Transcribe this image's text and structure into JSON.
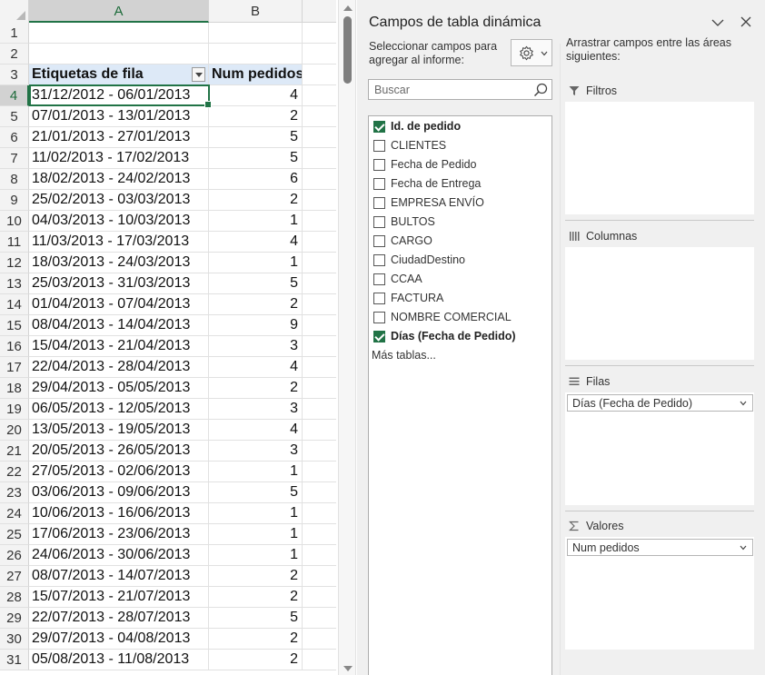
{
  "sheet": {
    "columns": [
      "A",
      "B"
    ],
    "selected_column": "A",
    "selected_row": "4",
    "header_row": {
      "number": "3",
      "label_col": "Etiquetas de fila",
      "value_col": "Num pedidos"
    },
    "empty_rows": [
      "1",
      "2"
    ],
    "rows": [
      {
        "n": "4",
        "label": "31/12/2012 - 06/01/2013",
        "value": "4"
      },
      {
        "n": "5",
        "label": "07/01/2013 - 13/01/2013",
        "value": "2"
      },
      {
        "n": "6",
        "label": "21/01/2013 - 27/01/2013",
        "value": "5"
      },
      {
        "n": "7",
        "label": "11/02/2013 - 17/02/2013",
        "value": "5"
      },
      {
        "n": "8",
        "label": "18/02/2013 - 24/02/2013",
        "value": "6"
      },
      {
        "n": "9",
        "label": "25/02/2013 - 03/03/2013",
        "value": "2"
      },
      {
        "n": "10",
        "label": "04/03/2013 - 10/03/2013",
        "value": "1"
      },
      {
        "n": "11",
        "label": "11/03/2013 - 17/03/2013",
        "value": "4"
      },
      {
        "n": "12",
        "label": "18/03/2013 - 24/03/2013",
        "value": "1"
      },
      {
        "n": "13",
        "label": "25/03/2013 - 31/03/2013",
        "value": "5"
      },
      {
        "n": "14",
        "label": "01/04/2013 - 07/04/2013",
        "value": "2"
      },
      {
        "n": "15",
        "label": "08/04/2013 - 14/04/2013",
        "value": "9"
      },
      {
        "n": "16",
        "label": "15/04/2013 - 21/04/2013",
        "value": "3"
      },
      {
        "n": "17",
        "label": "22/04/2013 - 28/04/2013",
        "value": "4"
      },
      {
        "n": "18",
        "label": "29/04/2013 - 05/05/2013",
        "value": "2"
      },
      {
        "n": "19",
        "label": "06/05/2013 - 12/05/2013",
        "value": "3"
      },
      {
        "n": "20",
        "label": "13/05/2013 - 19/05/2013",
        "value": "4"
      },
      {
        "n": "21",
        "label": "20/05/2013 - 26/05/2013",
        "value": "3"
      },
      {
        "n": "22",
        "label": "27/05/2013 - 02/06/2013",
        "value": "1"
      },
      {
        "n": "23",
        "label": "03/06/2013 - 09/06/2013",
        "value": "5"
      },
      {
        "n": "24",
        "label": "10/06/2013 - 16/06/2013",
        "value": "1"
      },
      {
        "n": "25",
        "label": "17/06/2013 - 23/06/2013",
        "value": "1"
      },
      {
        "n": "26",
        "label": "24/06/2013 - 30/06/2013",
        "value": "1"
      },
      {
        "n": "27",
        "label": "08/07/2013 - 14/07/2013",
        "value": "2"
      },
      {
        "n": "28",
        "label": "15/07/2013 - 21/07/2013",
        "value": "2"
      },
      {
        "n": "29",
        "label": "22/07/2013 - 28/07/2013",
        "value": "5"
      },
      {
        "n": "30",
        "label": "29/07/2013 - 04/08/2013",
        "value": "2"
      },
      {
        "n": "31",
        "label": "05/08/2013 - 11/08/2013",
        "value": "2"
      }
    ]
  },
  "pane": {
    "title": "Campos de tabla dinámica",
    "choose_fields_label": "Seleccionar campos para agregar al informe:",
    "search_placeholder": "Buscar",
    "fields": [
      {
        "label": "Id. de pedido",
        "checked": true
      },
      {
        "label": "CLIENTES",
        "checked": false
      },
      {
        "label": "Fecha de Pedido",
        "checked": false
      },
      {
        "label": "Fecha de Entrega",
        "checked": false
      },
      {
        "label": "EMPRESA ENVÍO",
        "checked": false
      },
      {
        "label": "BULTOS",
        "checked": false
      },
      {
        "label": "CARGO",
        "checked": false
      },
      {
        "label": "CiudadDestino",
        "checked": false
      },
      {
        "label": "CCAA",
        "checked": false
      },
      {
        "label": "FACTURA",
        "checked": false
      },
      {
        "label": "NOMBRE COMERCIAL",
        "checked": false
      },
      {
        "label": "Días (Fecha de Pedido)",
        "checked": true
      }
    ],
    "more_tables": "Más tablas...",
    "drag_label": "Arrastrar campos entre las áreas siguientes:",
    "areas": {
      "filters": {
        "label": "Filtros",
        "icon": "filter-icon",
        "items": []
      },
      "columns": {
        "label": "Columnas",
        "icon": "columns-icon",
        "items": []
      },
      "rows": {
        "label": "Filas",
        "icon": "rows-icon",
        "items": [
          "Días (Fecha de Pedido)"
        ]
      },
      "values": {
        "label": "Valores",
        "icon": "sigma-icon",
        "items": [
          "Num pedidos"
        ]
      }
    }
  },
  "colors": {
    "accent": "#217346",
    "pivot_header_fill": "#dde9f7"
  }
}
